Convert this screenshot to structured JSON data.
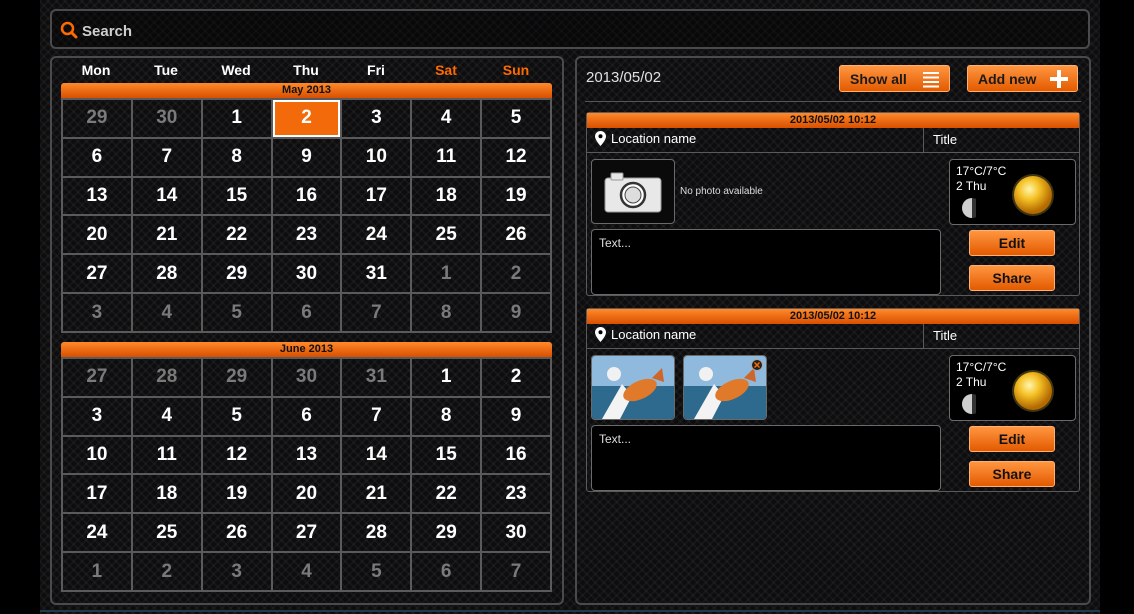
{
  "search": {
    "placeholder": "Search"
  },
  "calendar": {
    "weekdays": [
      "Mon",
      "Tue",
      "Wed",
      "Thu",
      "Fri",
      "Sat",
      "Sun"
    ],
    "months": [
      {
        "name": "May 2013",
        "days": [
          {
            "d": "29",
            "other": true
          },
          {
            "d": "30",
            "other": true
          },
          {
            "d": "1"
          },
          {
            "d": "2",
            "selected": true
          },
          {
            "d": "3"
          },
          {
            "d": "4"
          },
          {
            "d": "5"
          },
          {
            "d": "6"
          },
          {
            "d": "7"
          },
          {
            "d": "8"
          },
          {
            "d": "9"
          },
          {
            "d": "10"
          },
          {
            "d": "11"
          },
          {
            "d": "12"
          },
          {
            "d": "13"
          },
          {
            "d": "14"
          },
          {
            "d": "15"
          },
          {
            "d": "16"
          },
          {
            "d": "17"
          },
          {
            "d": "18"
          },
          {
            "d": "19"
          },
          {
            "d": "20"
          },
          {
            "d": "21"
          },
          {
            "d": "22"
          },
          {
            "d": "23"
          },
          {
            "d": "24"
          },
          {
            "d": "25"
          },
          {
            "d": "26"
          },
          {
            "d": "27"
          },
          {
            "d": "28"
          },
          {
            "d": "29"
          },
          {
            "d": "30"
          },
          {
            "d": "31"
          },
          {
            "d": "1",
            "other": true
          },
          {
            "d": "2",
            "other": true
          },
          {
            "d": "3",
            "other": true
          },
          {
            "d": "4",
            "other": true
          },
          {
            "d": "5",
            "other": true
          },
          {
            "d": "6",
            "other": true
          },
          {
            "d": "7",
            "other": true
          },
          {
            "d": "8",
            "other": true
          },
          {
            "d": "9",
            "other": true
          }
        ]
      },
      {
        "name": "June 2013",
        "days": [
          {
            "d": "27",
            "other": true
          },
          {
            "d": "28",
            "other": true
          },
          {
            "d": "29",
            "other": true
          },
          {
            "d": "30",
            "other": true
          },
          {
            "d": "31",
            "other": true
          },
          {
            "d": "1"
          },
          {
            "d": "2"
          },
          {
            "d": "3"
          },
          {
            "d": "4"
          },
          {
            "d": "5"
          },
          {
            "d": "6"
          },
          {
            "d": "7"
          },
          {
            "d": "8"
          },
          {
            "d": "9"
          },
          {
            "d": "10"
          },
          {
            "d": "11"
          },
          {
            "d": "12"
          },
          {
            "d": "13"
          },
          {
            "d": "14"
          },
          {
            "d": "15"
          },
          {
            "d": "16"
          },
          {
            "d": "17"
          },
          {
            "d": "18"
          },
          {
            "d": "19"
          },
          {
            "d": "20"
          },
          {
            "d": "21"
          },
          {
            "d": "22"
          },
          {
            "d": "23"
          },
          {
            "d": "24"
          },
          {
            "d": "25"
          },
          {
            "d": "26"
          },
          {
            "d": "27"
          },
          {
            "d": "28"
          },
          {
            "d": "29"
          },
          {
            "d": "30"
          },
          {
            "d": "1",
            "other": true
          },
          {
            "d": "2",
            "other": true
          },
          {
            "d": "3",
            "other": true
          },
          {
            "d": "4",
            "other": true
          },
          {
            "d": "5",
            "other": true
          },
          {
            "d": "6",
            "other": true
          },
          {
            "d": "7",
            "other": true
          }
        ]
      }
    ]
  },
  "detail": {
    "date": "2013/05/02",
    "show_all_label": "Show all",
    "add_new_label": "Add new",
    "entries": [
      {
        "datetime": "2013/05/02 10:12",
        "location": "Location name",
        "title": "Title",
        "no_photo_text": "No photo available",
        "text": "Text...",
        "temp": "17°C/7°C",
        "day": "2 Thu",
        "edit_label": "Edit",
        "share_label": "Share"
      },
      {
        "datetime": "2013/05/02 10:12",
        "location": "Location name",
        "title": "Title",
        "text": "Text...",
        "temp": "17°C/7°C",
        "day": "2 Thu",
        "edit_label": "Edit",
        "share_label": "Share"
      }
    ]
  },
  "colors": {
    "accent": "#f26a0a",
    "weekend": "#ff6a00",
    "grid_line": "#5a5a5a"
  },
  "icons": [
    "search-icon",
    "list-icon",
    "plus-icon",
    "location-pin-icon",
    "camera-icon",
    "sun-icon",
    "moon-icon",
    "close-icon"
  ]
}
